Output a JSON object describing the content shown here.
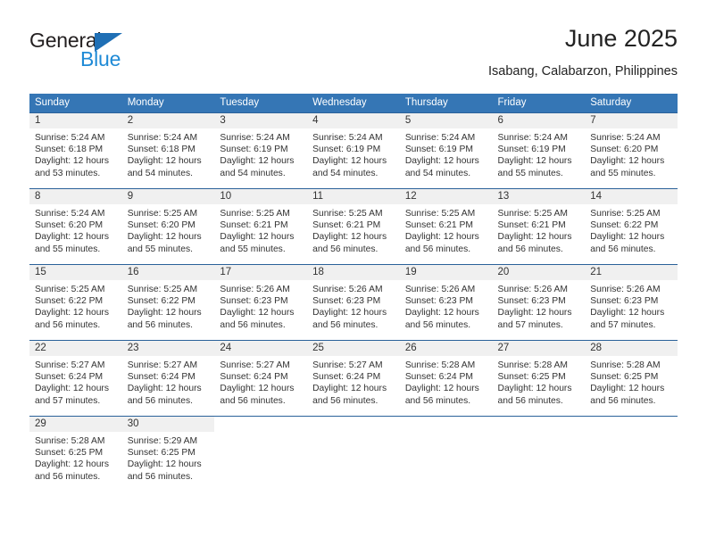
{
  "brand": {
    "name_part1": "General",
    "name_part2": "Blue",
    "triangle_icon": "triangle-icon",
    "color_dark": "#231f20",
    "color_blue": "#1f8ad6"
  },
  "header": {
    "title": "June 2025",
    "subtitle": "Isabang, Calabarzon, Philippines"
  },
  "theme": {
    "header_bg": "#3576b5",
    "row_divider": "#2a6199",
    "daynum_bg": "#f0f0f0"
  },
  "calendar": {
    "weekday_headers": [
      "Sunday",
      "Monday",
      "Tuesday",
      "Wednesday",
      "Thursday",
      "Friday",
      "Saturday"
    ],
    "weeks": [
      [
        {
          "day": "1",
          "sunrise": "Sunrise: 5:24 AM",
          "sunset": "Sunset: 6:18 PM",
          "daylight_1": "Daylight: 12 hours",
          "daylight_2": "and 53 minutes."
        },
        {
          "day": "2",
          "sunrise": "Sunrise: 5:24 AM",
          "sunset": "Sunset: 6:18 PM",
          "daylight_1": "Daylight: 12 hours",
          "daylight_2": "and 54 minutes."
        },
        {
          "day": "3",
          "sunrise": "Sunrise: 5:24 AM",
          "sunset": "Sunset: 6:19 PM",
          "daylight_1": "Daylight: 12 hours",
          "daylight_2": "and 54 minutes."
        },
        {
          "day": "4",
          "sunrise": "Sunrise: 5:24 AM",
          "sunset": "Sunset: 6:19 PM",
          "daylight_1": "Daylight: 12 hours",
          "daylight_2": "and 54 minutes."
        },
        {
          "day": "5",
          "sunrise": "Sunrise: 5:24 AM",
          "sunset": "Sunset: 6:19 PM",
          "daylight_1": "Daylight: 12 hours",
          "daylight_2": "and 54 minutes."
        },
        {
          "day": "6",
          "sunrise": "Sunrise: 5:24 AM",
          "sunset": "Sunset: 6:19 PM",
          "daylight_1": "Daylight: 12 hours",
          "daylight_2": "and 55 minutes."
        },
        {
          "day": "7",
          "sunrise": "Sunrise: 5:24 AM",
          "sunset": "Sunset: 6:20 PM",
          "daylight_1": "Daylight: 12 hours",
          "daylight_2": "and 55 minutes."
        }
      ],
      [
        {
          "day": "8",
          "sunrise": "Sunrise: 5:24 AM",
          "sunset": "Sunset: 6:20 PM",
          "daylight_1": "Daylight: 12 hours",
          "daylight_2": "and 55 minutes."
        },
        {
          "day": "9",
          "sunrise": "Sunrise: 5:25 AM",
          "sunset": "Sunset: 6:20 PM",
          "daylight_1": "Daylight: 12 hours",
          "daylight_2": "and 55 minutes."
        },
        {
          "day": "10",
          "sunrise": "Sunrise: 5:25 AM",
          "sunset": "Sunset: 6:21 PM",
          "daylight_1": "Daylight: 12 hours",
          "daylight_2": "and 55 minutes."
        },
        {
          "day": "11",
          "sunrise": "Sunrise: 5:25 AM",
          "sunset": "Sunset: 6:21 PM",
          "daylight_1": "Daylight: 12 hours",
          "daylight_2": "and 56 minutes."
        },
        {
          "day": "12",
          "sunrise": "Sunrise: 5:25 AM",
          "sunset": "Sunset: 6:21 PM",
          "daylight_1": "Daylight: 12 hours",
          "daylight_2": "and 56 minutes."
        },
        {
          "day": "13",
          "sunrise": "Sunrise: 5:25 AM",
          "sunset": "Sunset: 6:21 PM",
          "daylight_1": "Daylight: 12 hours",
          "daylight_2": "and 56 minutes."
        },
        {
          "day": "14",
          "sunrise": "Sunrise: 5:25 AM",
          "sunset": "Sunset: 6:22 PM",
          "daylight_1": "Daylight: 12 hours",
          "daylight_2": "and 56 minutes."
        }
      ],
      [
        {
          "day": "15",
          "sunrise": "Sunrise: 5:25 AM",
          "sunset": "Sunset: 6:22 PM",
          "daylight_1": "Daylight: 12 hours",
          "daylight_2": "and 56 minutes."
        },
        {
          "day": "16",
          "sunrise": "Sunrise: 5:25 AM",
          "sunset": "Sunset: 6:22 PM",
          "daylight_1": "Daylight: 12 hours",
          "daylight_2": "and 56 minutes."
        },
        {
          "day": "17",
          "sunrise": "Sunrise: 5:26 AM",
          "sunset": "Sunset: 6:23 PM",
          "daylight_1": "Daylight: 12 hours",
          "daylight_2": "and 56 minutes."
        },
        {
          "day": "18",
          "sunrise": "Sunrise: 5:26 AM",
          "sunset": "Sunset: 6:23 PM",
          "daylight_1": "Daylight: 12 hours",
          "daylight_2": "and 56 minutes."
        },
        {
          "day": "19",
          "sunrise": "Sunrise: 5:26 AM",
          "sunset": "Sunset: 6:23 PM",
          "daylight_1": "Daylight: 12 hours",
          "daylight_2": "and 56 minutes."
        },
        {
          "day": "20",
          "sunrise": "Sunrise: 5:26 AM",
          "sunset": "Sunset: 6:23 PM",
          "daylight_1": "Daylight: 12 hours",
          "daylight_2": "and 57 minutes."
        },
        {
          "day": "21",
          "sunrise": "Sunrise: 5:26 AM",
          "sunset": "Sunset: 6:23 PM",
          "daylight_1": "Daylight: 12 hours",
          "daylight_2": "and 57 minutes."
        }
      ],
      [
        {
          "day": "22",
          "sunrise": "Sunrise: 5:27 AM",
          "sunset": "Sunset: 6:24 PM",
          "daylight_1": "Daylight: 12 hours",
          "daylight_2": "and 57 minutes."
        },
        {
          "day": "23",
          "sunrise": "Sunrise: 5:27 AM",
          "sunset": "Sunset: 6:24 PM",
          "daylight_1": "Daylight: 12 hours",
          "daylight_2": "and 56 minutes."
        },
        {
          "day": "24",
          "sunrise": "Sunrise: 5:27 AM",
          "sunset": "Sunset: 6:24 PM",
          "daylight_1": "Daylight: 12 hours",
          "daylight_2": "and 56 minutes."
        },
        {
          "day": "25",
          "sunrise": "Sunrise: 5:27 AM",
          "sunset": "Sunset: 6:24 PM",
          "daylight_1": "Daylight: 12 hours",
          "daylight_2": "and 56 minutes."
        },
        {
          "day": "26",
          "sunrise": "Sunrise: 5:28 AM",
          "sunset": "Sunset: 6:24 PM",
          "daylight_1": "Daylight: 12 hours",
          "daylight_2": "and 56 minutes."
        },
        {
          "day": "27",
          "sunrise": "Sunrise: 5:28 AM",
          "sunset": "Sunset: 6:25 PM",
          "daylight_1": "Daylight: 12 hours",
          "daylight_2": "and 56 minutes."
        },
        {
          "day": "28",
          "sunrise": "Sunrise: 5:28 AM",
          "sunset": "Sunset: 6:25 PM",
          "daylight_1": "Daylight: 12 hours",
          "daylight_2": "and 56 minutes."
        }
      ],
      [
        {
          "day": "29",
          "sunrise": "Sunrise: 5:28 AM",
          "sunset": "Sunset: 6:25 PM",
          "daylight_1": "Daylight: 12 hours",
          "daylight_2": "and 56 minutes."
        },
        {
          "day": "30",
          "sunrise": "Sunrise: 5:29 AM",
          "sunset": "Sunset: 6:25 PM",
          "daylight_1": "Daylight: 12 hours",
          "daylight_2": "and 56 minutes."
        },
        {
          "day": "",
          "sunrise": "",
          "sunset": "",
          "daylight_1": "",
          "daylight_2": ""
        },
        {
          "day": "",
          "sunrise": "",
          "sunset": "",
          "daylight_1": "",
          "daylight_2": ""
        },
        {
          "day": "",
          "sunrise": "",
          "sunset": "",
          "daylight_1": "",
          "daylight_2": ""
        },
        {
          "day": "",
          "sunrise": "",
          "sunset": "",
          "daylight_1": "",
          "daylight_2": ""
        },
        {
          "day": "",
          "sunrise": "",
          "sunset": "",
          "daylight_1": "",
          "daylight_2": ""
        }
      ]
    ]
  }
}
